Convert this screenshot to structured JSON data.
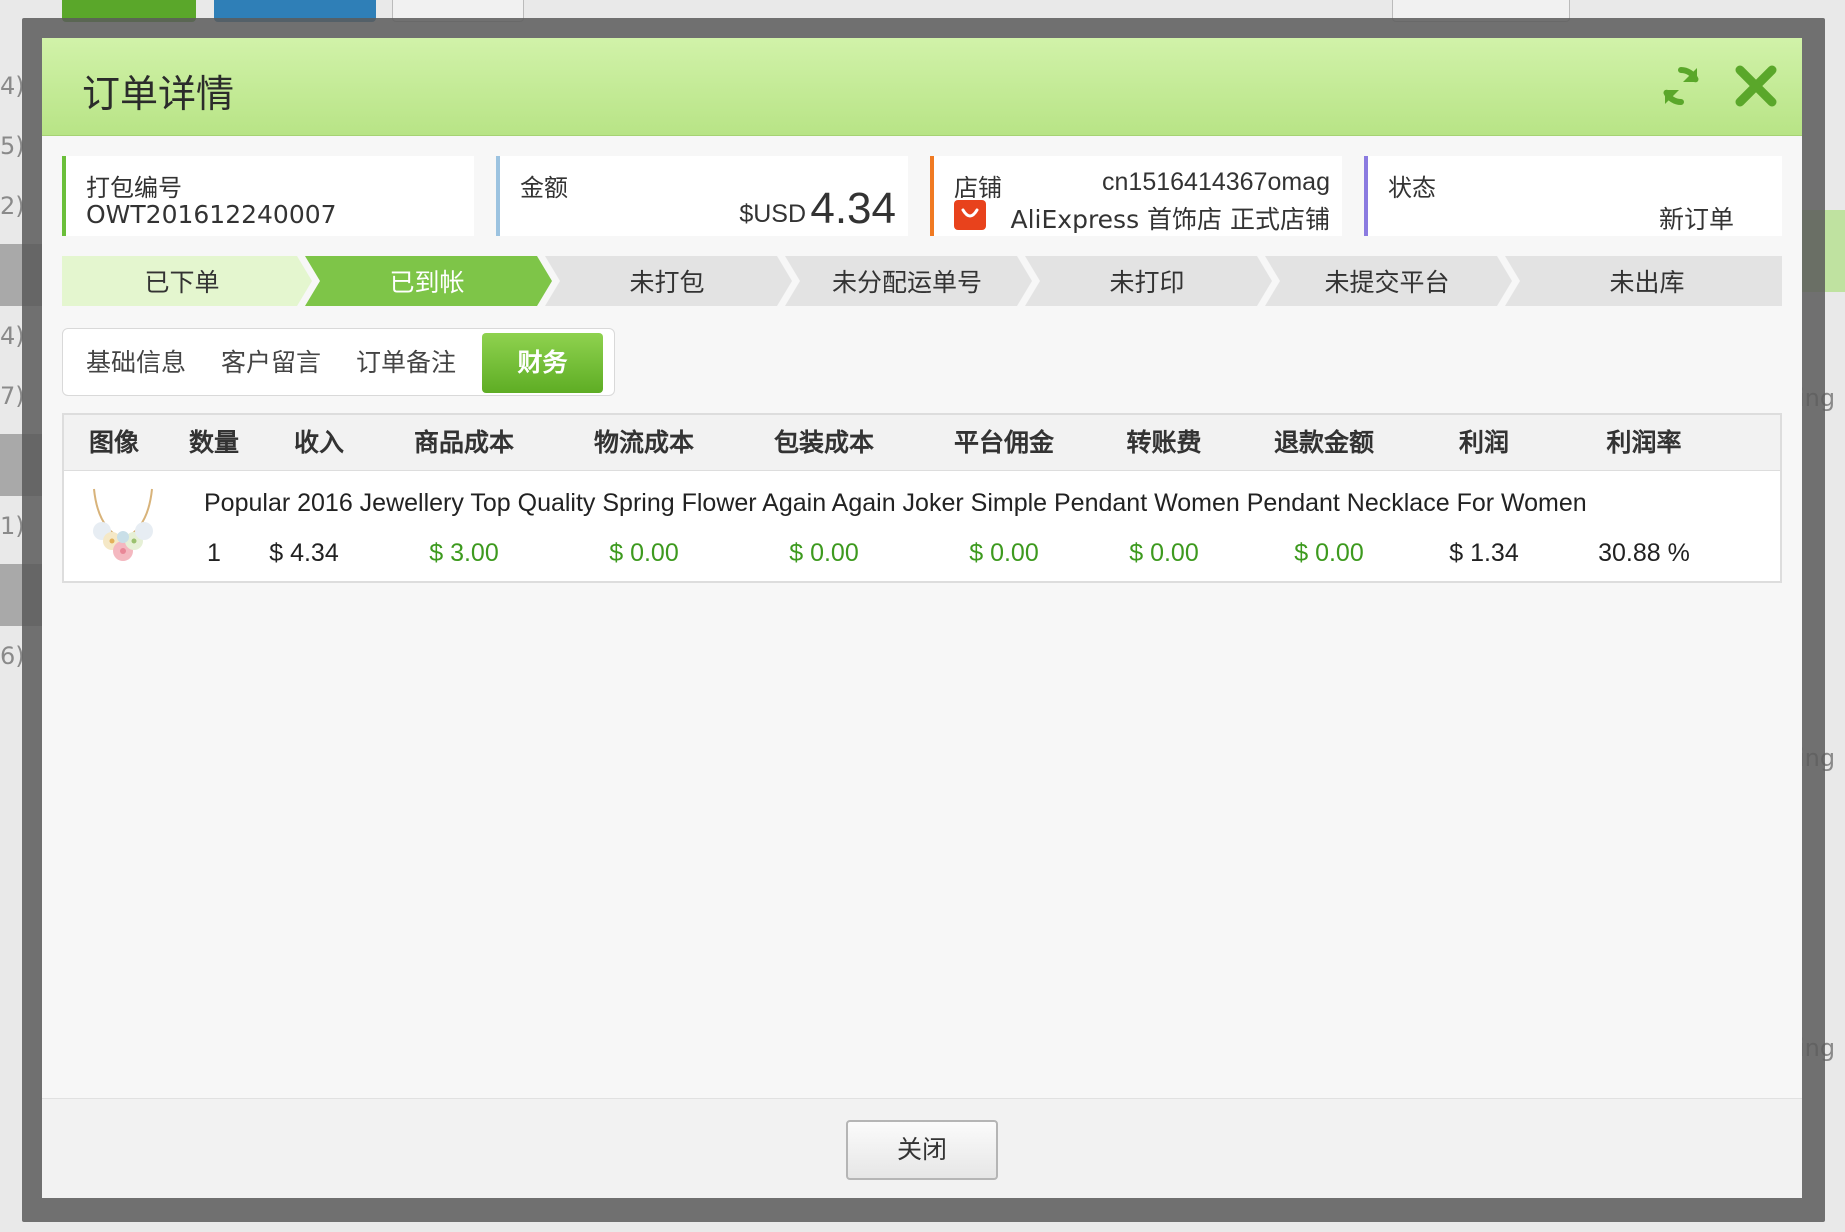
{
  "background": {
    "left_labels": [
      "4)",
      "5)",
      "2)",
      "4)",
      "7)",
      "1)",
      "6)"
    ],
    "right_labels": [
      "ing",
      "ing",
      "ing"
    ]
  },
  "modal": {
    "title": "订单详情",
    "icons": {
      "refresh": "refresh-icon",
      "close": "close-icon",
      "shop": "aliexpress-shop-icon"
    },
    "colors": {
      "header": "#c6ec9a",
      "accent": "#5ead24",
      "money_green": "#3d9a1e"
    }
  },
  "cards": {
    "pack": {
      "label": "打包编号",
      "value": "OWT201612240007"
    },
    "amount": {
      "label": "金额",
      "currency": "$USD",
      "value": "4.34"
    },
    "shop": {
      "label": "店铺",
      "shop_id": "cn1516414367omag",
      "shop_name": "AliExpress 首饰店 正式店铺"
    },
    "status": {
      "label": "状态",
      "value": "新订单"
    }
  },
  "steps": [
    {
      "label": "已下单",
      "state": "done"
    },
    {
      "label": "已到帐",
      "state": "current"
    },
    {
      "label": "未打包",
      "state": "pending"
    },
    {
      "label": "未分配运单号",
      "state": "pending"
    },
    {
      "label": "未打印",
      "state": "pending"
    },
    {
      "label": "未提交平台",
      "state": "pending"
    },
    {
      "label": "未出库",
      "state": "pending"
    }
  ],
  "tabs": [
    {
      "label": "基础信息",
      "active": false
    },
    {
      "label": "客户留言",
      "active": false
    },
    {
      "label": "订单备注",
      "active": false
    },
    {
      "label": "财务",
      "active": true
    }
  ],
  "finance": {
    "headers": [
      "图像",
      "数量",
      "收入",
      "商品成本",
      "物流成本",
      "包装成本",
      "平台佣金",
      "转账费",
      "退款金额",
      "利润",
      "利润率"
    ],
    "row": {
      "title": "Popular 2016 Jewellery Top Quality Spring Flower Again Again Joker Simple Pendant Women Pendant Necklace For Women",
      "quantity": "1",
      "income": "$ 4.34",
      "goods_cost": "$ 3.00",
      "shipping_cost": "$ 0.00",
      "packing_cost": "$ 0.00",
      "platform_fee": "$ 0.00",
      "transfer_fee": "$ 0.00",
      "refund": "$ 0.00",
      "profit": "$ 1.34",
      "margin": "30.88 %"
    }
  },
  "footer": {
    "close_label": "关闭"
  }
}
